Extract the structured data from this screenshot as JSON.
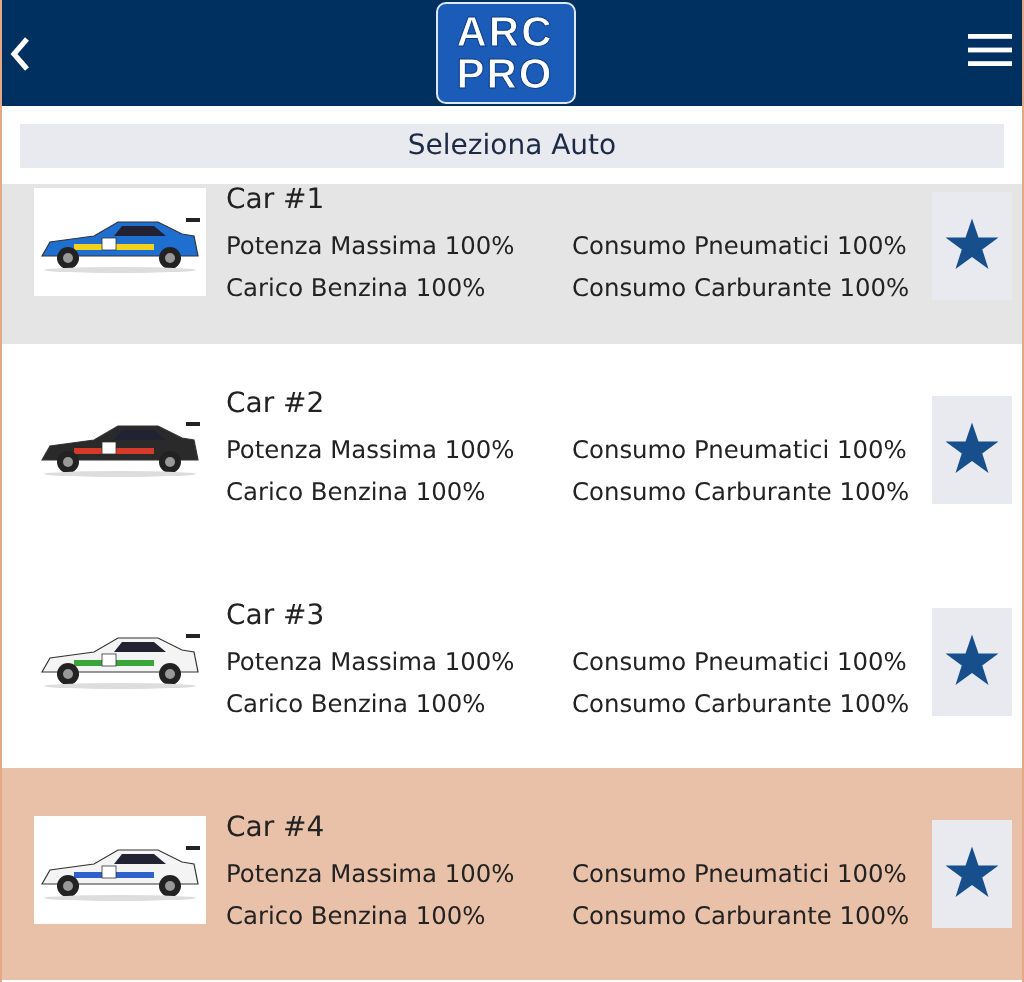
{
  "header": {
    "logo": [
      "ARC",
      "PRO"
    ]
  },
  "title": "Seleziona Auto",
  "cars": [
    {
      "name": "Car #1",
      "stats": [
        "Potenza Massima 100%",
        "Consumo Pneumatici 100%",
        "Carico Benzina 100%",
        "Consumo Carburante 100%"
      ],
      "highlighted": true,
      "selected": false
    },
    {
      "name": "Car #2",
      "stats": [
        "Potenza Massima 100%",
        "Consumo Pneumatici 100%",
        "Carico Benzina 100%",
        "Consumo Carburante 100%"
      ],
      "highlighted": false,
      "selected": false
    },
    {
      "name": "Car #3",
      "stats": [
        "Potenza Massima 100%",
        "Consumo Pneumatici 100%",
        "Carico Benzina 100%",
        "Consumo Carburante 100%"
      ],
      "highlighted": false,
      "selected": false
    },
    {
      "name": "Car #4",
      "stats": [
        "Potenza Massima 100%",
        "Consumo Pneumatici 100%",
        "Carico Benzina 100%",
        "Consumo Carburante 100%"
      ],
      "highlighted": false,
      "selected": true
    }
  ]
}
